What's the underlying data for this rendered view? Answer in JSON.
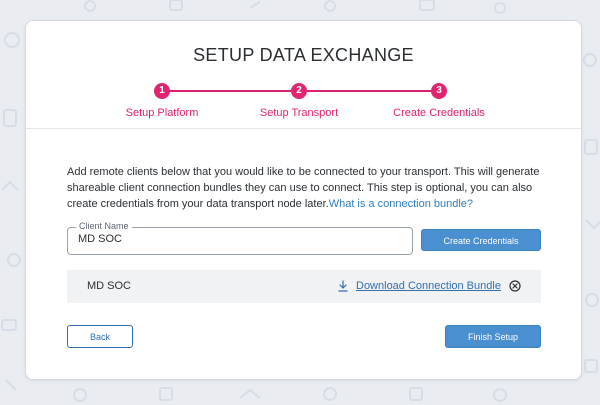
{
  "page": {
    "title": "SETUP DATA EXCHANGE"
  },
  "steps": [
    {
      "number": "1",
      "label": "Setup Platform"
    },
    {
      "number": "2",
      "label": "Setup Transport"
    },
    {
      "number": "3",
      "label": "Create Credentials"
    }
  ],
  "description": {
    "text": "Add remote clients below that you would like to be connected to your transport. This will generate shareable client connection bundles they can use to connect. This step is optional, you can also create credentials from your data transport node later.",
    "link_text": "What is a connection bundle?"
  },
  "client_form": {
    "label": "Client Name",
    "value": "MD SOC",
    "create_button": "Create Credentials"
  },
  "clients": [
    {
      "name": "MD SOC",
      "download_label": "Download Connection Bundle",
      "icons": [
        "download-icon",
        "remove-icon"
      ]
    }
  ],
  "footer": {
    "back_label": "Back",
    "finish_label": "Finish Setup"
  },
  "colors": {
    "accent_pink": "#e0246f",
    "primary_blue": "#4a8fcf",
    "link_blue": "#2f7fc1",
    "background": "#e9edf2"
  }
}
